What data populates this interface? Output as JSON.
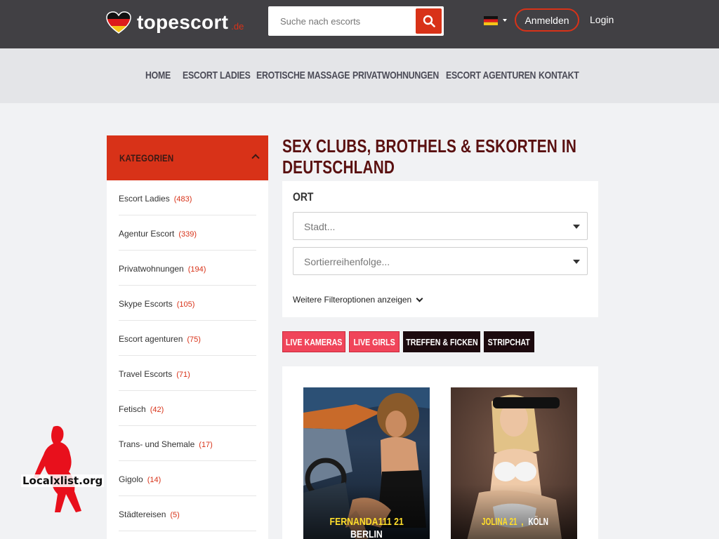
{
  "header": {
    "logo_text": "topescort",
    "logo_tld": ".de",
    "search_placeholder": "Suche nach escorts",
    "language": "DE",
    "register_label": "Anmelden",
    "login_label": "Login"
  },
  "nav": {
    "items": [
      "HOME",
      "ESCORT LADIES",
      "EROTISCHE MASSAGE",
      "PRIVATWOHNUNGEN",
      "ESCORT AGENTUREN",
      "KONTAKT"
    ]
  },
  "sidebar": {
    "title": "KATEGORIEN",
    "items": [
      {
        "label": "Escort Ladies",
        "count": "(483)"
      },
      {
        "label": "Agentur Escort",
        "count": "(339)"
      },
      {
        "label": "Privatwohnungen",
        "count": "(194)"
      },
      {
        "label": "Skype Escorts",
        "count": "(105)"
      },
      {
        "label": "Escort agenturen",
        "count": "(75)"
      },
      {
        "label": "Travel Escorts",
        "count": "(71)"
      },
      {
        "label": "Fetisch",
        "count": "(42)"
      },
      {
        "label": "Trans- und Shemale",
        "count": "(17)"
      },
      {
        "label": "Gigolo",
        "count": "(14)"
      },
      {
        "label": "Städtereisen",
        "count": "(5)"
      }
    ]
  },
  "main": {
    "title": "SEX CLUBS, BROTHELS & ESKORTEN IN DEUTSCHLAND",
    "filter": {
      "section_label": "ORT",
      "city_placeholder": "Stadt...",
      "sort_placeholder": "Sortierreihenfolge...",
      "more_filters": "Weitere Filteroptionen anzeigen"
    },
    "tags": [
      "LIVE KAMERAS",
      "LIVE GIRLS",
      "TREFFEN & FICKEN",
      "STRIPCHAT"
    ],
    "profiles": [
      {
        "name": "FERNANDA111 21",
        "city": "BERLIN"
      },
      {
        "name": "JOLINA 21",
        "city": "KÖLN"
      }
    ]
  },
  "watermark": {
    "text": "Localxlist.org"
  },
  "colors": {
    "header_bg": "#414044",
    "accent": "#d83218",
    "tag_red": "#f0455a",
    "tag_dark": "#1c0a0e",
    "title": "#5a1010",
    "name_yellow": "#ffde2b"
  }
}
